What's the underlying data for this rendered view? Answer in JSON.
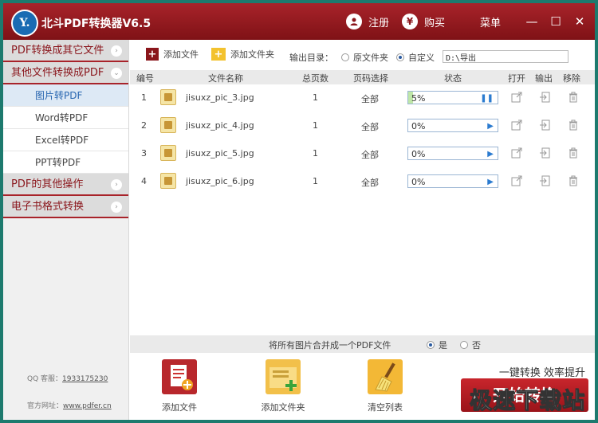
{
  "app": {
    "logo_text": "Y.",
    "title": "北斗PDF转换器V6.5"
  },
  "titlebar": {
    "register_label": "注册",
    "register_icon": "user-icon",
    "buy_label": "购买",
    "buy_icon": "yen-icon",
    "buy_glyph": "¥",
    "menu_label": "菜单",
    "menu_icon": "grid-menu-icon",
    "minimize": "—",
    "maximize": "☐",
    "close": "✕"
  },
  "sidebar": {
    "cat_pdf_to_other": "PDF转换成其它文件",
    "cat_other_to_pdf": "其他文件转换成PDF",
    "sub_items": [
      "图片转PDF",
      "Word转PDF",
      "Excel转PDF",
      "PPT转PDF"
    ],
    "active_sub": 0,
    "cat_pdf_other_ops": "PDF的其他操作",
    "cat_ebook": "电子书格式转换",
    "qq_label": "QQ 客服：",
    "qq_value": "1933175230",
    "site_label": "官方网址：",
    "site_value": "www.pdfer.cn"
  },
  "toolbar": {
    "add_file": "添加文件",
    "add_folder": "添加文件夹",
    "output_dir_label": "输出目录：",
    "opt_source": "原文件夹",
    "opt_custom": "自定义",
    "selected_output": "custom",
    "output_path": "D:\\导出"
  },
  "table": {
    "headers": [
      "编号",
      "文件名称",
      "总页数",
      "页码选择",
      "状态",
      "打开",
      "输出",
      "移除"
    ],
    "rows": [
      {
        "no": "1",
        "name": "jisuxz_pic_3.jpg",
        "pages": "1",
        "range": "全部",
        "status": "5%",
        "progress": 0.05,
        "state": "paused"
      },
      {
        "no": "2",
        "name": "jisuxz_pic_4.jpg",
        "pages": "1",
        "range": "全部",
        "status": "0%",
        "progress": 0,
        "state": "waiting"
      },
      {
        "no": "3",
        "name": "jisuxz_pic_5.jpg",
        "pages": "1",
        "range": "全部",
        "status": "0%",
        "progress": 0,
        "state": "waiting"
      },
      {
        "no": "4",
        "name": "jisuxz_pic_6.jpg",
        "pages": "1",
        "range": "全部",
        "status": "0%",
        "progress": 0,
        "state": "waiting"
      }
    ]
  },
  "merge": {
    "label": "将所有图片合并成一个PDF文件",
    "yes": "是",
    "no": "否",
    "selected": "yes"
  },
  "bottom": {
    "add_file": "添加文件",
    "add_folder": "添加文件夹",
    "clear_list": "清空列表",
    "slogan": "一键转换  效率提升",
    "convert": "开始转换",
    "watermark": "极速下载站"
  },
  "colors": {
    "brand_red": "#a8232a",
    "accent_blue": "#2866b0",
    "progress_green": "#bfe7a8"
  }
}
